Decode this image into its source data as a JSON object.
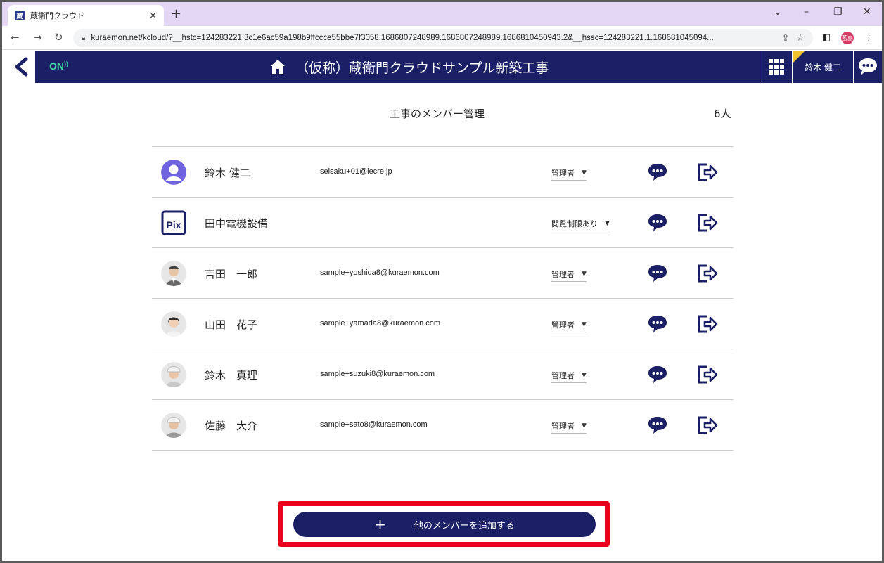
{
  "browser": {
    "tab_title": "蔵衛門クラウド",
    "tab_close": "×",
    "new_tab": "+",
    "win_min": "–",
    "win_max": "❐",
    "win_close": "✕",
    "win_menu": "⌄",
    "url": "kuraemon.net/kcloud/?__hstc=124283221.3c1e6ac59a198b9ffccce55bbe7f3058.1686807248989.1686807248989.1686810450943.2&__hssc=124283221.1.168681045094...",
    "profile_label": "藍島"
  },
  "header": {
    "status": "ON",
    "project_title": "（仮称）蔵衛門クラウドサンプル新築工事",
    "user_name": "鈴木 健二"
  },
  "page": {
    "title": "工事のメンバー管理",
    "count": "6人"
  },
  "members": [
    {
      "name": "鈴木 健二",
      "email": "seisaku+01@lecre.jp",
      "role": "管理者"
    },
    {
      "name": "田中電機設備",
      "email": "",
      "role": "閲覧制限あり"
    },
    {
      "name": "吉田　一郎",
      "email": "sample+yoshida8@kuraemon.com",
      "role": "管理者"
    },
    {
      "name": "山田　花子",
      "email": "sample+yamada8@kuraemon.com",
      "role": "管理者"
    },
    {
      "name": "鈴木　真理",
      "email": "sample+suzuki8@kuraemon.com",
      "role": "管理者"
    },
    {
      "name": "佐藤　大介",
      "email": "sample+sato8@kuraemon.com",
      "role": "管理者"
    }
  ],
  "role_caret": "▼",
  "add_button": {
    "icon": "+",
    "label": "他のメンバーを追加する"
  },
  "avatar_pix_text": "Pix",
  "colors": {
    "navy": "#1b2066",
    "accent_green": "#3fd9a8",
    "highlight_red": "#e8001c"
  }
}
